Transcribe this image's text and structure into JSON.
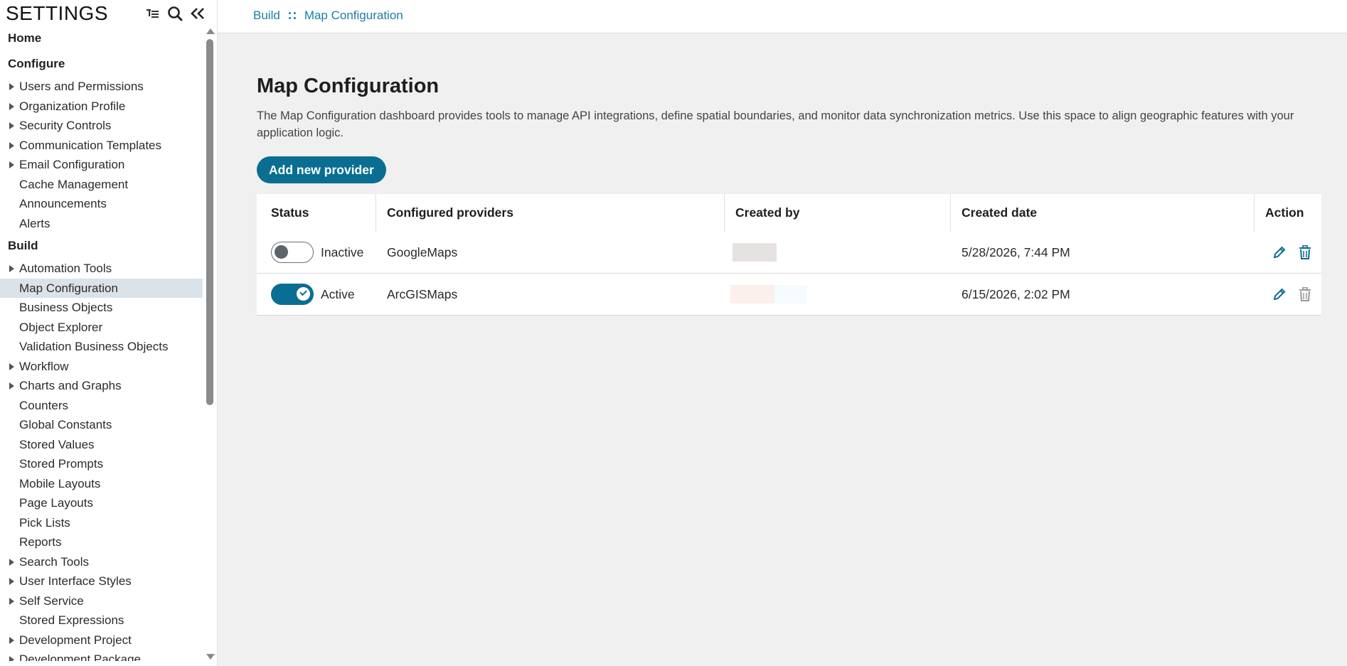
{
  "sidebar": {
    "title": "SETTINGS",
    "sections": {
      "home": "Home",
      "configure": "Configure",
      "build": "Build"
    },
    "configure_items": [
      {
        "label": "Users and Permissions",
        "expandable": true
      },
      {
        "label": "Organization Profile",
        "expandable": true
      },
      {
        "label": "Security Controls",
        "expandable": true
      },
      {
        "label": "Communication Templates",
        "expandable": true
      },
      {
        "label": "Email Configuration",
        "expandable": true
      },
      {
        "label": "Cache Management",
        "expandable": false
      },
      {
        "label": "Announcements",
        "expandable": false
      },
      {
        "label": "Alerts",
        "expandable": false
      }
    ],
    "build_items": [
      {
        "label": "Automation Tools",
        "expandable": true
      },
      {
        "label": "Map Configuration",
        "expandable": false,
        "selected": true
      },
      {
        "label": "Business Objects",
        "expandable": false
      },
      {
        "label": "Object Explorer",
        "expandable": false
      },
      {
        "label": "Validation Business Objects",
        "expandable": false
      },
      {
        "label": "Workflow",
        "expandable": true
      },
      {
        "label": "Charts and Graphs",
        "expandable": true
      },
      {
        "label": "Counters",
        "expandable": false
      },
      {
        "label": "Global Constants",
        "expandable": false
      },
      {
        "label": "Stored Values",
        "expandable": false
      },
      {
        "label": "Stored Prompts",
        "expandable": false
      },
      {
        "label": "Mobile Layouts",
        "expandable": false
      },
      {
        "label": "Page Layouts",
        "expandable": false
      },
      {
        "label": "Pick Lists",
        "expandable": false
      },
      {
        "label": "Reports",
        "expandable": false
      },
      {
        "label": "Search Tools",
        "expandable": true
      },
      {
        "label": "User Interface Styles",
        "expandable": true
      },
      {
        "label": "Self Service",
        "expandable": true
      },
      {
        "label": "Stored Expressions",
        "expandable": false
      },
      {
        "label": "Development Project",
        "expandable": true
      },
      {
        "label": "Development Package",
        "expandable": true
      }
    ],
    "tools": [
      "tree-menu-icon",
      "search-icon",
      "collapse-icon"
    ]
  },
  "breadcrumb": {
    "parent": "Build",
    "current": "Map Configuration"
  },
  "main": {
    "title": "Map Configuration",
    "description": "The Map Configuration dashboard provides tools to manage API integrations, define spatial boundaries, and monitor data synchronization metrics. Use this space to align geographic features with your application logic.",
    "add_button": "Add new provider"
  },
  "table": {
    "columns": {
      "status": "Status",
      "provider": "Configured providers",
      "created_by": "Created by",
      "created_date": "Created date",
      "action": "Action"
    },
    "rows": [
      {
        "status": "Inactive",
        "active": false,
        "provider": "GoogleMaps",
        "created_date": "5/28/2026, 7:44 PM"
      },
      {
        "status": "Active",
        "active": true,
        "provider": "ArcGISMaps",
        "created_date": "6/15/2026, 2:02 PM"
      }
    ]
  },
  "colors": {
    "accent": "#0a6e93",
    "link": "#1a7fa6",
    "selected_bg": "#dbe3ea",
    "redaction_row1": "#e6e2e2",
    "redaction_row2_a": "#fbf0eb",
    "redaction_row2_b": "#f6fbfd"
  }
}
